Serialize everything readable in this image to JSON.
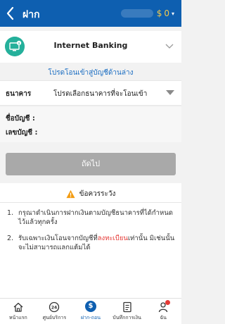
{
  "header": {
    "title": "ฝาก",
    "currency": "$",
    "balance": "0",
    "caret": "▾"
  },
  "method": {
    "label": "Internet Banking"
  },
  "choose_bank_msg": "โปรดโอนเข้าสู่บัญชีด้านล่าง",
  "bank": {
    "label": "ธนาคาร",
    "placeholder": "โปรดเลือกธนาคารที่จะโอนเข้า"
  },
  "account": {
    "name_label": "ชื่อบัญชี :",
    "number_label": "เลขบัญชี :"
  },
  "next_button": "ถัดไป",
  "warning": {
    "title": "ข้อควรระวัง",
    "notes": [
      {
        "num": "1.",
        "text": "กรุณาดำเนินการฝากเงินตามบัญชีธนาคารที่ได้กำหนดไว้แล้วทุกครั้ง"
      },
      {
        "num": "2.",
        "pre": "รับเฉพาะเงินโอนจากบัญชีที่",
        "highlight": "ลงทะเบียน",
        "post": "เท่านั้น มิเช่นนั้นจะไม่สามารถแลกแต้มได้"
      }
    ]
  },
  "tabs": [
    {
      "label": "หน้าแรก",
      "icon": "home-icon"
    },
    {
      "label": "ศูนย์บริการ",
      "icon": "24h-service-icon"
    },
    {
      "label": "ฝาก-ถอน",
      "icon": "dollar-icon"
    },
    {
      "label": "บันทึกการเงิน",
      "icon": "document-icon"
    },
    {
      "label": "ฉัน",
      "icon": "person-icon"
    }
  ],
  "colors": {
    "header_blue": "#0e5fb0",
    "accent_teal": "#25b09b",
    "button_grey": "#a9a9a9",
    "warning_orange": "#f39c12",
    "highlight_red": "#e53935"
  }
}
